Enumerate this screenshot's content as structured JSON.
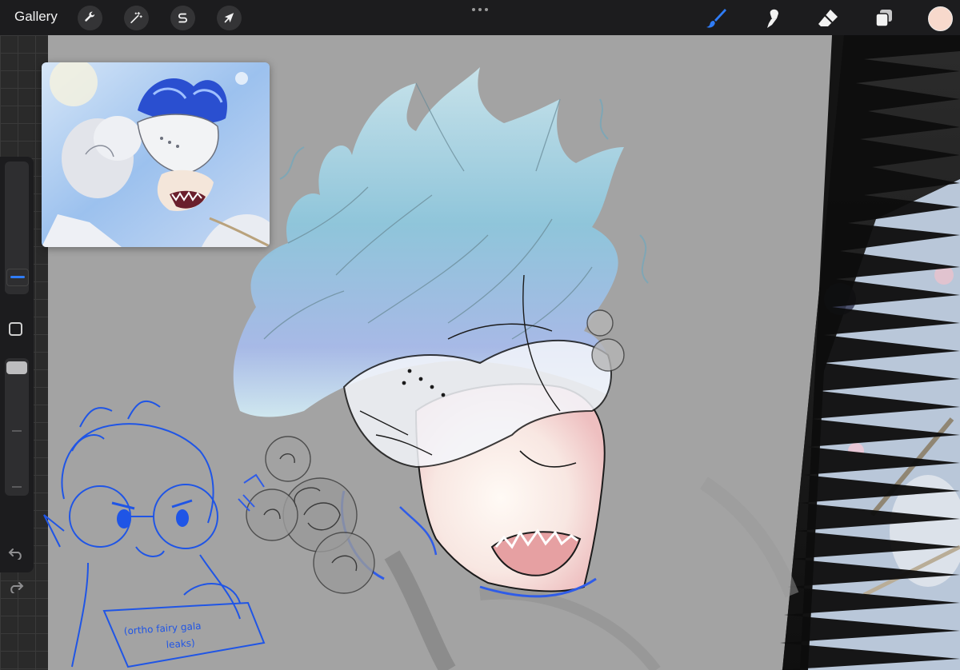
{
  "topbar": {
    "gallery_label": "Gallery",
    "left_tools": [
      {
        "name": "actions",
        "icon": "wrench-icon"
      },
      {
        "name": "adjustments",
        "icon": "magic-wand-icon"
      },
      {
        "name": "selection",
        "icon": "selection-s-icon"
      },
      {
        "name": "transform",
        "icon": "arrow-cursor-icon"
      }
    ],
    "right_tools": [
      {
        "name": "brush",
        "icon": "brush-icon",
        "active": true
      },
      {
        "name": "smudge",
        "icon": "smudge-icon",
        "active": false
      },
      {
        "name": "eraser",
        "icon": "eraser-icon",
        "active": false
      },
      {
        "name": "layers",
        "icon": "layers-icon",
        "active": false
      }
    ],
    "current_color": "#f7d9cc",
    "accent_color": "#2f7cf6"
  },
  "sidebar": {
    "brush_size_level": 0.73,
    "opacity_level": 0.95
  },
  "canvas": {
    "sketch_note": "(ortho fairy gala leaks)",
    "sketch_note_line1": "(ortho fairy gala",
    "sketch_note_line2": "leaks)"
  }
}
